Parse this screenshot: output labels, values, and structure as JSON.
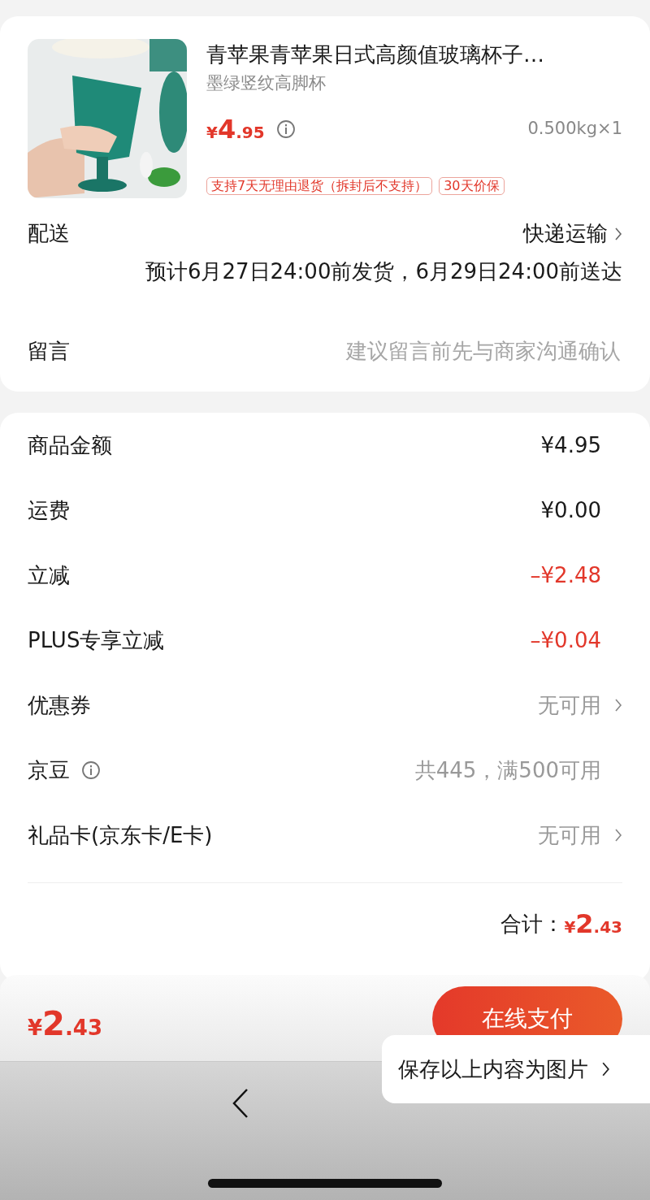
{
  "product": {
    "title": "青苹果青苹果日式高颜值玻璃杯子…",
    "spec": "墨绿竖纹高脚杯",
    "price": {
      "symbol": "¥",
      "integer": "4",
      "decimals": ".95"
    },
    "weight": "0.500kg×1",
    "tags": [
      "支持7天无理由退货（拆封后不支持）",
      "30天价保"
    ]
  },
  "delivery": {
    "label": "配送",
    "method": "快递运输",
    "estimate": "预计6月27日24:00前发货，6月29日24:00前送达"
  },
  "message": {
    "label": "留言",
    "placeholder": "建议留言前先与商家沟通确认"
  },
  "summary": [
    {
      "label": "商品金额",
      "value": "¥4.95",
      "kind": "plain",
      "info": false
    },
    {
      "label": "运费",
      "value": "¥0.00",
      "kind": "plain",
      "info": false
    },
    {
      "label": "立减",
      "value": "–¥2.48",
      "kind": "discount",
      "info": false
    },
    {
      "label": "PLUS专享立减",
      "value": "–¥0.04",
      "kind": "discount",
      "info": false
    },
    {
      "label": "优惠券",
      "value": "无可用",
      "kind": "link",
      "info": false
    },
    {
      "label": "京豆",
      "value": "共445，满500可用",
      "kind": "muted",
      "info": true
    },
    {
      "label": "礼品卡(京东卡/E卡)",
      "value": "无可用",
      "kind": "link",
      "info": false
    }
  ],
  "total": {
    "label": "合计：",
    "price": {
      "symbol": "¥",
      "integer": "2",
      "decimals": ".43"
    }
  },
  "bottom_bar": {
    "price": {
      "symbol": "¥",
      "integer": "2",
      "decimals": ".43"
    },
    "pay_button": "在线支付"
  },
  "popup": {
    "text": "保存以上内容为图片"
  }
}
